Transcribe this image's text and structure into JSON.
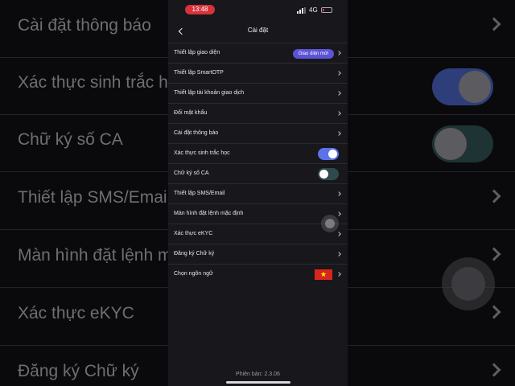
{
  "background": {
    "rows": [
      {
        "label": "Cài đặt thông báo",
        "control": "chevron"
      },
      {
        "label": "Xác thực sinh trắc học",
        "control": "toggle-on"
      },
      {
        "label": "Chữ ký số CA",
        "control": "toggle-off"
      },
      {
        "label": "Thiết lập SMS/Email",
        "control": "chevron"
      },
      {
        "label": "Màn hình đặt lệnh mặc định",
        "control": "chevron"
      },
      {
        "label": "Xác thực eKYC",
        "control": "chevron"
      },
      {
        "label": "Đăng ký Chữ ký",
        "control": "chevron"
      }
    ]
  },
  "status_bar": {
    "time": "13:48",
    "network": "4G",
    "signal_icon": "signal-bars-icon",
    "battery_icon": "battery-low-icon"
  },
  "header": {
    "title": "Cài đặt",
    "back_icon": "chevron-left-icon"
  },
  "settings": {
    "items": [
      {
        "label": "Thiết lập giao diện",
        "badge": "Giao diện mới",
        "control": "chevron"
      },
      {
        "label": "Thiết lập SmartOTP",
        "control": "chevron"
      },
      {
        "label": "Thiết lập tài khoản giao dịch",
        "control": "chevron"
      },
      {
        "label": "Đổi mật khẩu",
        "control": "chevron"
      },
      {
        "label": "Cài đặt thông báo",
        "control": "chevron"
      },
      {
        "label": "Xác thực sinh trắc học",
        "control": "toggle",
        "toggle_on": true
      },
      {
        "label": "Chữ ký số CA",
        "control": "toggle",
        "toggle_on": false
      },
      {
        "label": "Thiết lập SMS/Email",
        "control": "chevron"
      },
      {
        "label": "Màn hình đặt lệnh mặc định",
        "control": "chevron"
      },
      {
        "label": "Xác thực eKYC",
        "control": "chevron"
      },
      {
        "label": "Đăng ký Chữ ký",
        "control": "chevron"
      },
      {
        "label": "Chọn ngôn ngữ",
        "flag": "vietnam-flag-icon",
        "control": "chevron"
      }
    ]
  },
  "footer": {
    "version": "Phiên bản: 2.3.06"
  },
  "colors": {
    "badge": "#5b53d6",
    "toggle_on": "#5b72e8",
    "toggle_off": "#2f4a4c",
    "time_pill": "#d8323a",
    "background": "#18171c"
  }
}
